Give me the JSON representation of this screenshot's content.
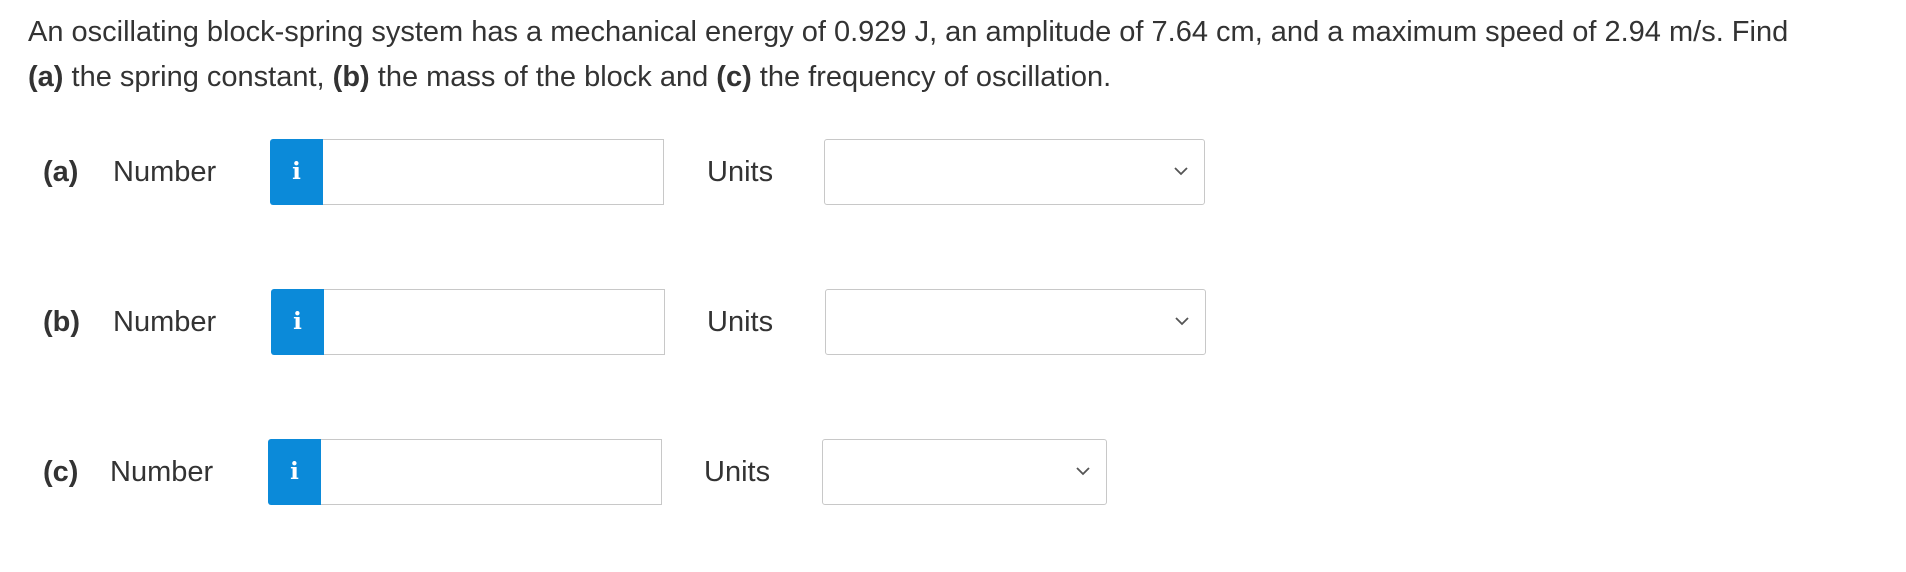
{
  "question": {
    "line1": "An oscillating block-spring system has a mechanical energy of 0.929 J, an amplitude of 7.64 cm, and a maximum speed of 2.94 m/s. Find",
    "part_a": "(a)",
    "text_a": " the spring constant, ",
    "part_b": "(b)",
    "text_b": " the mass of the block and ",
    "part_c": "(c)",
    "text_c": " the frequency of oscillation."
  },
  "answers": [
    {
      "part_label": "(a)",
      "number_label": "Number",
      "info_icon": "i",
      "number_value": "",
      "units_label": "Units",
      "units_selected": ""
    },
    {
      "part_label": "(b)",
      "number_label": "Number",
      "info_icon": "i",
      "number_value": "",
      "units_label": "Units",
      "units_selected": ""
    },
    {
      "part_label": "(c)",
      "number_label": "Number",
      "info_icon": "i",
      "number_value": "",
      "units_label": "Units",
      "units_selected": ""
    }
  ],
  "colors": {
    "info_button": "#0b8ad9",
    "text": "#333333",
    "border": "#c8c8c8"
  }
}
